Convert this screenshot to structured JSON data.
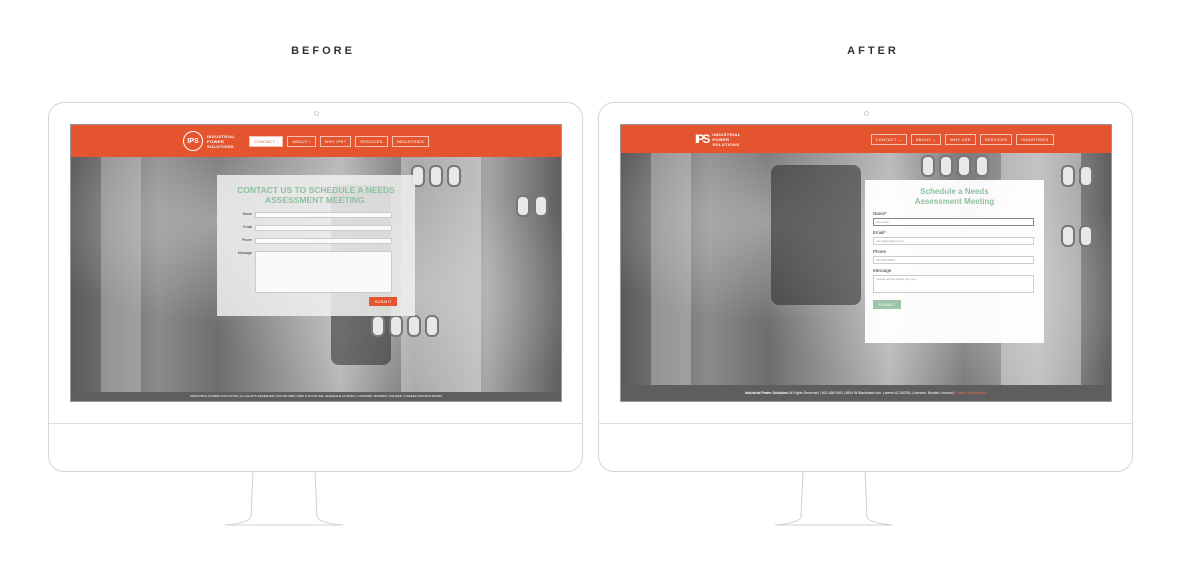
{
  "headings": {
    "before": "BEFORE",
    "after": "AFTER"
  },
  "brand": {
    "logo_text_lines": [
      "INDUSTRIAL",
      "POWER",
      "SOLUTIONS"
    ],
    "logo_mark": "IPS",
    "accent_color": "#e4552f",
    "form_title_color": "#8fc0a0"
  },
  "before": {
    "nav": [
      "CONTACT ›",
      "ABOUT ›",
      "WHY IPS?",
      "SERVICES",
      "INDUSTRIES"
    ],
    "form": {
      "title_line1": "CONTACT US TO SCHEDULE A NEEDS",
      "title_line2": "ASSESSMENT MEETING.",
      "labels": {
        "name": "Name",
        "email": "Email",
        "phone": "Phone",
        "message": "Message"
      },
      "submit": "SUBMIT"
    },
    "footer": "INDUSTRIAL POWER SOLUTIONS, ALL RIGHTS RESERVED  |  602.466.0962  |  6824 N STATE AVE. GLENDALE AZ 85301  |  LICENSED, BONDED, INSURED  |  CAREER OPPORTUNITIES"
  },
  "after": {
    "nav": [
      "CONTACT ⌄",
      "ABOUT ⌄",
      "WHY USE",
      "SERVICES",
      "INDUSTRIES"
    ],
    "form": {
      "title_line1": "Schedule a Needs",
      "title_line2": "Assessment Meeting",
      "labels": {
        "name": "Name*",
        "email": "Email*",
        "phone": "Phone",
        "message": "Message"
      },
      "placeholders": {
        "name": "John Doe",
        "email": "name@address.com",
        "phone": "000-000-0000",
        "message": "Include all the details you can"
      },
      "submit": "SUBMIT"
    },
    "footer": {
      "brand": "Industrial Power Solutions",
      "text": " All Rights Reserved. | 602.466.0962 | 6824 W Blackhawk Ave. Laveen AZ 85339 | Licensed, Bonded, Insured | ",
      "link": "Career Opportunities"
    }
  }
}
